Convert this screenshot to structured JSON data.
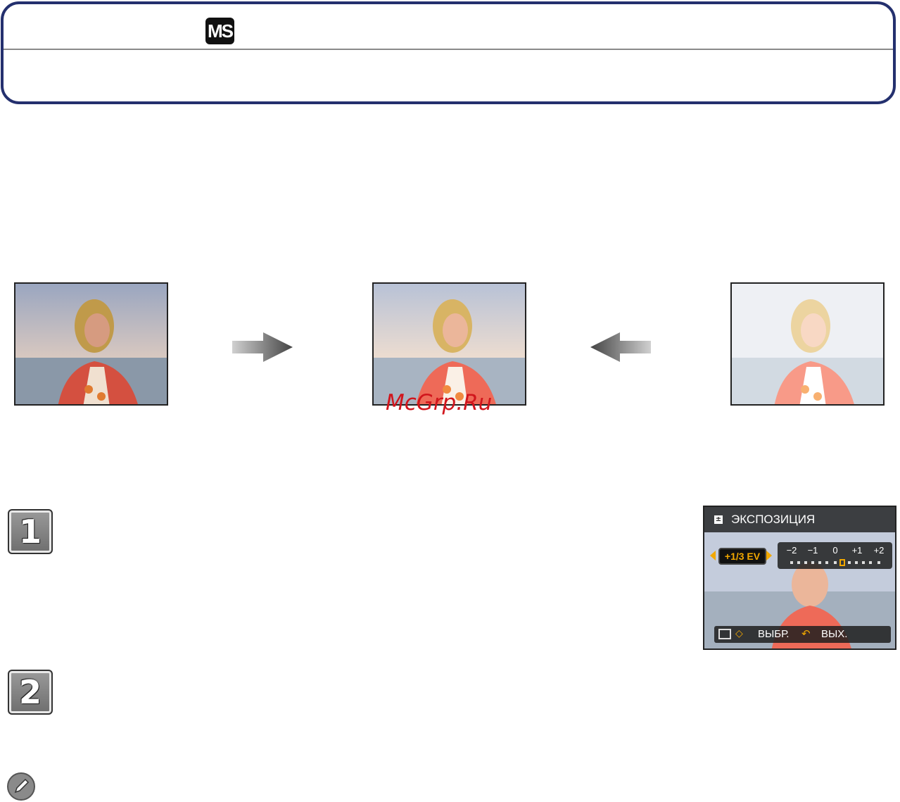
{
  "header": {
    "mode_badge": "MS",
    "mode_badge_icon": "manual-scene-mode-icon"
  },
  "illustration": {
    "arrow_right_icon": "arrow-right-icon",
    "arrow_left_icon": "arrow-left-icon",
    "watermark": "McGrp.Ru"
  },
  "steps": [
    {
      "number": "1"
    },
    {
      "number": "2"
    }
  ],
  "camera_screen": {
    "title": "ЭКСПОЗИЦИЯ",
    "ev_value": "+1/3 EV",
    "scale_labels": [
      "−2",
      "−1",
      "0",
      "+1",
      "+2"
    ],
    "footer_select": "ВЫБР.",
    "footer_exit": "ВЫХ."
  },
  "note": {
    "icon": "pencil-note-icon"
  },
  "colors": {
    "header_border": "#24306e",
    "watermark": "#d1151c",
    "highlight": "#f2a800"
  }
}
